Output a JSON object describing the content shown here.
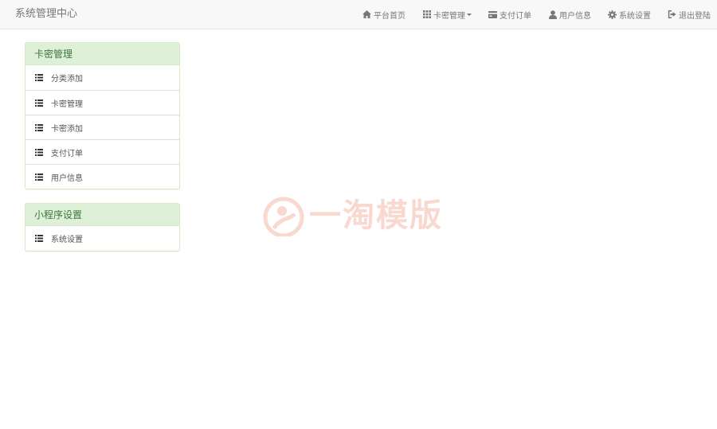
{
  "app": {
    "title": "系统管理中心"
  },
  "nav": {
    "items": [
      {
        "label": "平台首页",
        "icon": "home-icon"
      },
      {
        "label": "卡密管理",
        "icon": "grid-icon",
        "dropdown": true
      },
      {
        "label": "支付订单",
        "icon": "credit-card-icon"
      },
      {
        "label": "用户信息",
        "icon": "user-icon"
      },
      {
        "label": "系统设置",
        "icon": "gear-icon"
      },
      {
        "label": "退出登陆",
        "icon": "logout-icon"
      }
    ]
  },
  "sidebar": {
    "panels": [
      {
        "heading": "卡密管理",
        "items": [
          {
            "label": "分类添加",
            "icon": "list-icon"
          },
          {
            "label": "卡密管理",
            "icon": "list-icon"
          },
          {
            "label": "卡密添加",
            "icon": "list-icon"
          },
          {
            "label": "支付订单",
            "icon": "list-icon"
          },
          {
            "label": "用户信息",
            "icon": "list-icon"
          }
        ]
      },
      {
        "heading": "小程序设置",
        "items": [
          {
            "label": "系统设置",
            "icon": "list-icon"
          }
        ]
      }
    ]
  },
  "watermark": {
    "text": "一淘模版",
    "color": "#e8502a"
  },
  "colors": {
    "navbar_bg": "#f8f8f8",
    "panel_heading_bg": "#dff0d8",
    "panel_heading_text": "#3c763d",
    "panel_border": "#d6e9c6"
  }
}
